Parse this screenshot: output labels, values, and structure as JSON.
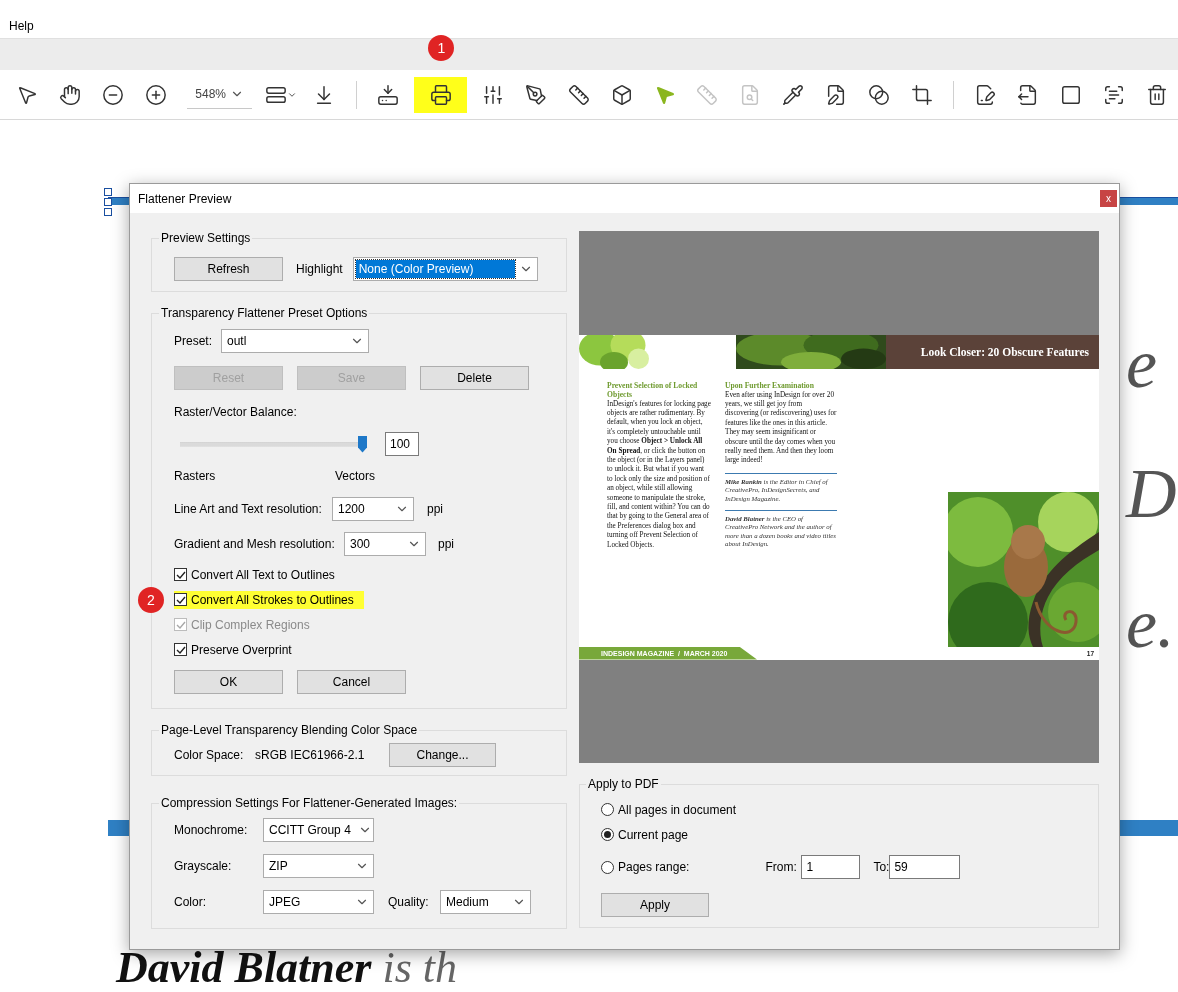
{
  "menu_bar": {
    "items": [
      "Help"
    ]
  },
  "toolbar": {
    "items": [
      {
        "kind": "icon",
        "selected": false,
        "disabled": false
      },
      {
        "kind": "icon",
        "selected": false,
        "disabled": false
      },
      {
        "kind": "icon",
        "selected": false,
        "disabled": false
      },
      {
        "kind": "icon",
        "selected": false,
        "disabled": false
      },
      {
        "kind": "zoom",
        "value": "548%"
      },
      {
        "kind": "icon",
        "selected": false,
        "disabled": false,
        "caret": true
      },
      {
        "kind": "icon",
        "selected": false,
        "disabled": false
      },
      {
        "kind": "separator"
      },
      {
        "kind": "icon",
        "selected": false,
        "disabled": false
      },
      {
        "kind": "icon",
        "selected": false,
        "disabled": false,
        "annotated": true,
        "badge": "1"
      },
      {
        "kind": "icon",
        "selected": false,
        "disabled": false
      },
      {
        "kind": "icon",
        "selected": false,
        "disabled": false
      },
      {
        "kind": "icon",
        "selected": false,
        "disabled": false
      },
      {
        "kind": "icon",
        "selected": false,
        "disabled": false
      },
      {
        "kind": "icon",
        "selected": true,
        "disabled": false
      },
      {
        "kind": "icon",
        "selected": false,
        "disabled": true
      },
      {
        "kind": "icon",
        "selected": false,
        "disabled": true
      },
      {
        "kind": "icon",
        "selected": false,
        "disabled": false
      },
      {
        "kind": "icon",
        "selected": false,
        "disabled": false
      },
      {
        "kind": "icon",
        "selected": false,
        "disabled": false
      },
      {
        "kind": "icon",
        "selected": false,
        "disabled": false
      },
      {
        "kind": "separator"
      },
      {
        "kind": "icon",
        "selected": false,
        "disabled": false
      },
      {
        "kind": "icon",
        "selected": false,
        "disabled": false
      },
      {
        "kind": "icon",
        "selected": false,
        "disabled": false
      },
      {
        "kind": "icon",
        "selected": false,
        "disabled": false
      },
      {
        "kind": "icon",
        "selected": false,
        "disabled": false
      }
    ]
  },
  "document": {
    "lines": [
      {
        "right": "e"
      },
      {
        "right": "D"
      },
      {
        "right": "e."
      }
    ],
    "footer_line": "**David Blatner** is th"
  },
  "dialog": {
    "title": "Flattener Preview",
    "close": "x",
    "preview_settings": {
      "title": "Preview Settings",
      "refresh": "Refresh",
      "highlight_label": "Highlight",
      "highlight": {
        "value": "None (Color Preview)",
        "focused": true
      }
    },
    "preset_options": {
      "title": "Transparency Flattener Preset Options",
      "preset_label": "Preset:",
      "preset": "outl",
      "buttons": [
        {
          "label": "Reset",
          "disabled": true
        },
        {
          "label": "Save",
          "disabled": true
        },
        {
          "label": "Delete",
          "disabled": false
        }
      ],
      "balance_label": "Raster/Vector Balance:",
      "balance": {
        "level": 1.0,
        "value": "100"
      },
      "rasters": "Rasters",
      "vectors": "Vectors",
      "line_art": {
        "label": "Line Art and Text resolution:",
        "value": "1200",
        "unit": "ppi"
      },
      "gradient": {
        "label": "Gradient and Mesh resolution:",
        "value": "300",
        "unit": "ppi"
      },
      "checkboxes": [
        {
          "label": "Convert All Text to Outlines",
          "checked": true,
          "disabled": false,
          "annotated": false
        },
        {
          "label": "Convert All Strokes to Outlines",
          "checked": true,
          "disabled": false,
          "annotated": true,
          "badge": "2"
        },
        {
          "label": "Clip Complex Regions",
          "checked": true,
          "disabled": true,
          "annotated": false
        },
        {
          "label": "Preserve Overprint",
          "checked": true,
          "disabled": false,
          "annotated": false
        }
      ],
      "ok": "OK",
      "cancel": "Cancel"
    },
    "color_space": {
      "title": "Page-Level Transparency Blending Color Space",
      "label": "Color Space:",
      "value": "sRGB IEC61966-2.1",
      "change": "Change..."
    },
    "compression": {
      "title": "Compression Settings For Flattener-Generated Images:",
      "monochrome": {
        "label": "Monochrome:",
        "value": "CCITT Group 4"
      },
      "grayscale": {
        "label": "Grayscale:",
        "value": "ZIP"
      },
      "color": {
        "label": "Color:",
        "value": "JPEG"
      },
      "quality": {
        "label": "Quality:",
        "value": "Medium"
      }
    },
    "preview_page": {
      "header": "Look Closer: 20 Obscure Features",
      "columns": [
        {
          "heading": "Prevent Selection of Locked Objects",
          "text": "InDesign's features for locking page objects are rather rudimentary. By default, when you lock an object, it's completely untouchable until you choose **Object > Unlock All On Spread**, or click the button on the object (or in the Layers panel) to unlock it. But what if you want to lock only the size and position of an object, while still allowing someone to manipulate the stroke, fill, and content within? You can do that by going to the General area of the Preferences dialog box and turning off Prevent Selection of Locked Objects."
        },
        {
          "heading": "Upon Further Examination",
          "text": "Even after using InDesign for over 20 years, we still get joy from discovering (or rediscovering) uses for features like the ones in this article. They may seem insignificant or obscure until the day comes when you really need them. And then they loom large indeed!"
        }
      ],
      "bios": [
        "**Mike Rankin** is the Editor in Chief of CreativePro, InDesignSecrets, and InDesign Magazine.",
        "**David Blatner** is the CEO of CreativePro Network and the author of more than a dozen books and video titles about InDesign."
      ],
      "footer": "INDESIGN MAGAZINE  /  MARCH 2020",
      "page_number": "17"
    },
    "apply": {
      "title": "Apply to PDF",
      "options": [
        {
          "label": "All pages in document",
          "selected": false
        },
        {
          "label": "Current page",
          "selected": true
        },
        {
          "label": "Pages range:",
          "selected": false
        }
      ],
      "from_label": "From:",
      "from": "1",
      "to_label": "To:",
      "to": "59",
      "button": "Apply"
    }
  }
}
